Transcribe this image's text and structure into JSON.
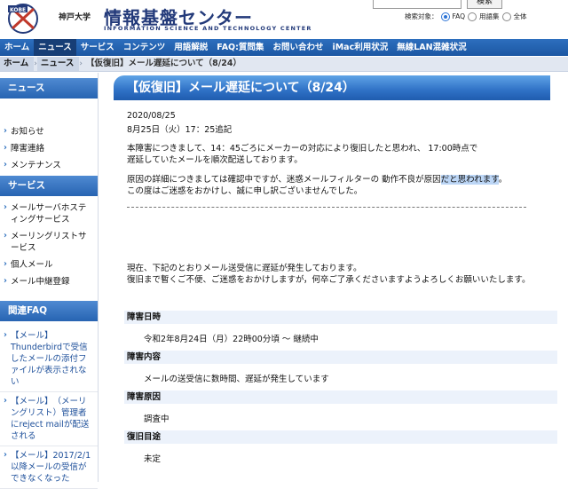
{
  "header": {
    "emblem_text": "KOBE",
    "univ_name": "神戸大学",
    "center_name": "情報基盤センター",
    "center_name_en": "INFORMATION SCIENCE AND TECHNOLOGY CENTER",
    "search": {
      "button_label": "検索",
      "scope_label": "検索対象：",
      "options": [
        "FAQ",
        "用語集",
        "全体"
      ],
      "selected": "FAQ"
    }
  },
  "gnav": {
    "items": [
      "ホーム",
      "ニュース",
      "サービス",
      "コンテンツ",
      "用語解説",
      "FAQ:質問集",
      "お問い合わせ",
      "iMac利用状況",
      "無線LAN混雑状況"
    ],
    "active": "ニュース"
  },
  "breadcrumb": {
    "items": [
      "ホーム",
      "ニュース"
    ],
    "current": "【仮復旧】メール遅延について（8/24）"
  },
  "sidebar": {
    "news_head": "ニュース",
    "news_items": [
      "お知らせ",
      "障害連絡",
      "メンテナンス"
    ],
    "service_head": "サービス",
    "service_items": [
      "メールサーバホスティングサービス",
      "メーリングリストサービス",
      "個人メール",
      "メール中継登録"
    ],
    "faq_head": "関連FAQ",
    "faq_items": [
      "【メール】Thunderbirdで受信したメールの添付ファイルが表示されない",
      "【メール】　（メーリングリスト）管理者にreject mailが配送される",
      "【メール】2017/2/1以降メールの受信ができなくなった"
    ]
  },
  "main": {
    "title": "【仮復旧】メール遅延について（8/24）",
    "date": "2020/08/25",
    "update_note": "8月25日（火）17：25追記",
    "para1_line1": "本障害につきまして、14：45ごろにメーカーの対応により復旧したと思われ、 17:00時点で",
    "para1_line2": "遅延していたメールを順次配送しております。",
    "para2_line1_a": "原因の詳細につきましては確認中ですが、迷惑メールフィルターの 動作不良が原因",
    "para2_line1_b": "だと思われます",
    "para2_line1_c": "。",
    "para2_line2": "この度はご迷惑をおかけし、誠に申し訳ございませんでした。",
    "para3_line1": "現在、下記のとおりメール送受信に遅延が発生しております。",
    "para3_line2": "復旧まで暫くご不便、ご迷惑をおかけしますが，何卒ご了承くださいますようよろしくお願いいたします。",
    "sections": [
      {
        "head": "障害日時",
        "body": "令和2年8月24日（月）22時00分頃 〜 継続中"
      },
      {
        "head": "障害内容",
        "body": "メールの送受信に数時間、遅延が発生しています"
      },
      {
        "head": "障害原因",
        "body": "調査中"
      },
      {
        "head": "復旧目途",
        "body": "未定"
      }
    ]
  }
}
